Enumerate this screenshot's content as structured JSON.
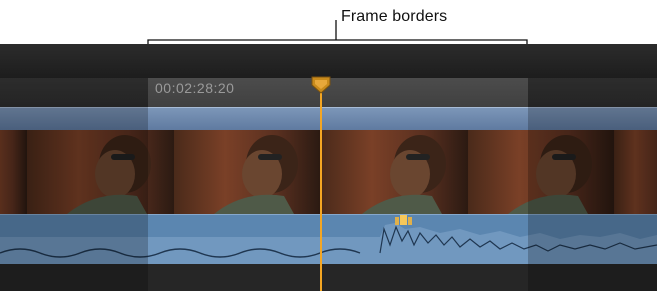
{
  "callout": {
    "label": "Frame borders"
  },
  "ruler": {
    "timecode": "00:02:28:20"
  },
  "colors": {
    "playhead": "#f4a623",
    "clip_bar": "#6f8aae",
    "audio_waveform": "#5b86b0",
    "background": "#2e2e2e"
  },
  "icons": {
    "playhead": "playhead-handle-icon",
    "marker": "marker-icon"
  }
}
